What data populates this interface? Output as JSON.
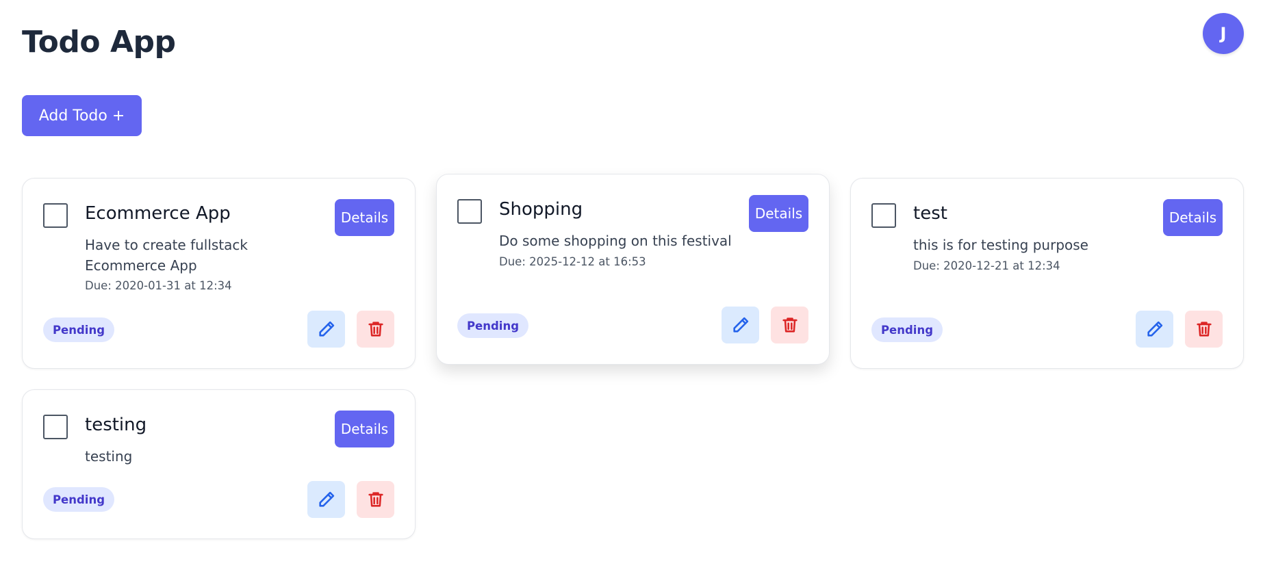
{
  "header": {
    "title": "Todo App",
    "avatar_initial": "J"
  },
  "toolbar": {
    "add_label": "Add Todo +"
  },
  "todos": [
    {
      "title": "Ecommerce App",
      "description": "Have to create fullstack Ecommerce App",
      "due": "Due: 2020-01-31 at 12:34",
      "status": "Pending",
      "details_label": "Details"
    },
    {
      "title": "Shopping",
      "description": "Do some shopping on this festival",
      "due": "Due: 2025-12-12 at 16:53",
      "status": "Pending",
      "details_label": "Details"
    },
    {
      "title": "test",
      "description": "this is for testing purpose",
      "due": "Due: 2020-12-21 at 12:34",
      "status": "Pending",
      "details_label": "Details"
    },
    {
      "title": "testing",
      "description": "testing",
      "status": "Pending",
      "details_label": "Details"
    }
  ],
  "colors": {
    "accent": "#6366f1",
    "edit_icon": "#2563eb",
    "delete_icon": "#dc2626"
  },
  "icons": {
    "edit": "pencil-icon",
    "delete": "trash-icon"
  }
}
